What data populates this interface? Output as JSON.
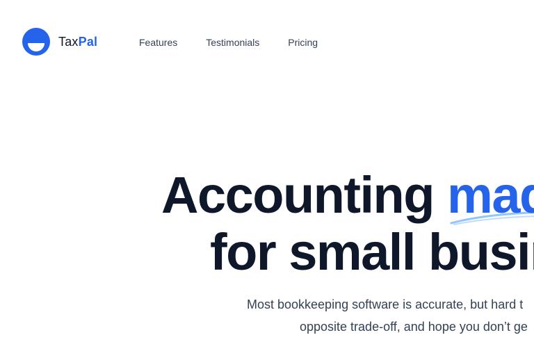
{
  "brand": {
    "name_part1": "Tax",
    "name_part2": "Pal",
    "logo_icon": "half-circle-logo-icon",
    "colors": {
      "primary": "#2563eb",
      "dark": "#0f172a"
    }
  },
  "nav": {
    "items": [
      {
        "label": "Features"
      },
      {
        "label": "Testimonials"
      },
      {
        "label": "Pricing"
      }
    ]
  },
  "hero": {
    "title_line1_plain": "Accounting ",
    "title_line1_highlight": "mad",
    "title_line2": "for small busin",
    "subtitle_line1": "Most bookkeeping software is accurate, but hard t",
    "subtitle_line2": "opposite trade-off, and hope you don’t ge"
  }
}
